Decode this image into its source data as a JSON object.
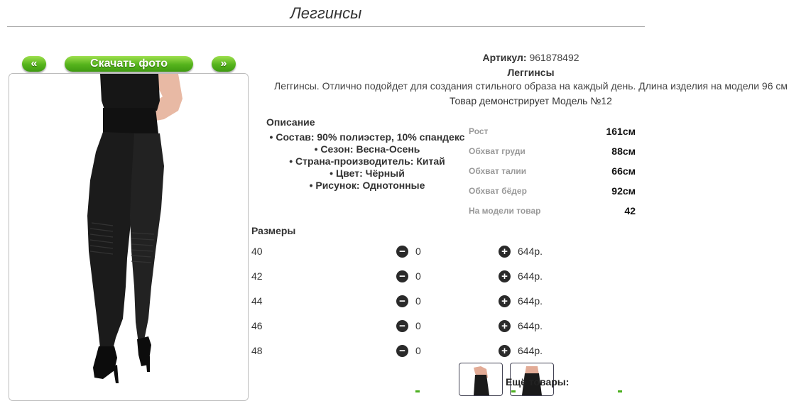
{
  "page": {
    "title": "Леггинсы"
  },
  "photo_nav": {
    "prev": "«",
    "download": "Скачать фото",
    "next": "»"
  },
  "product": {
    "article_label": "Артикул:",
    "article_value": "961878492",
    "name": "Леггинсы",
    "description": "Леггинсы. Отлично подойдет для создания стильного образа на каждый день. Длина изделия на модели 96 см",
    "model_note": "Товар демонстрирует Модель №12"
  },
  "details": {
    "title": "Описание",
    "items": [
      "Состав: 90% полиэстер, 10% спандекс",
      "Сезон: Весна-Осень",
      "Страна-производитель: Китай",
      "Цвет: Чёрный",
      "Рисунок: Однотонные"
    ]
  },
  "model": {
    "rows": [
      {
        "label": "Рост",
        "value": "161см"
      },
      {
        "label": "Обхват груди",
        "value": "88см"
      },
      {
        "label": "Обхват талии",
        "value": "66см"
      },
      {
        "label": "Обхват бёдер",
        "value": "92см"
      },
      {
        "label": "На модели товар",
        "value": "42"
      }
    ]
  },
  "sizes": {
    "title": "Размеры",
    "minus_icon": "minus-circle-icon",
    "plus_icon": "plus-circle-icon",
    "rows": [
      {
        "size": "40",
        "qty": "0",
        "price": "644р."
      },
      {
        "size": "42",
        "qty": "0",
        "price": "644р."
      },
      {
        "size": "44",
        "qty": "0",
        "price": "644р."
      },
      {
        "size": "46",
        "qty": "0",
        "price": "644р."
      },
      {
        "size": "48",
        "qty": "0",
        "price": "644р."
      }
    ]
  },
  "more": {
    "title": "Ещё товары:"
  },
  "colors": {
    "button_green": "#55b31c",
    "link_green": "#4caf20"
  }
}
